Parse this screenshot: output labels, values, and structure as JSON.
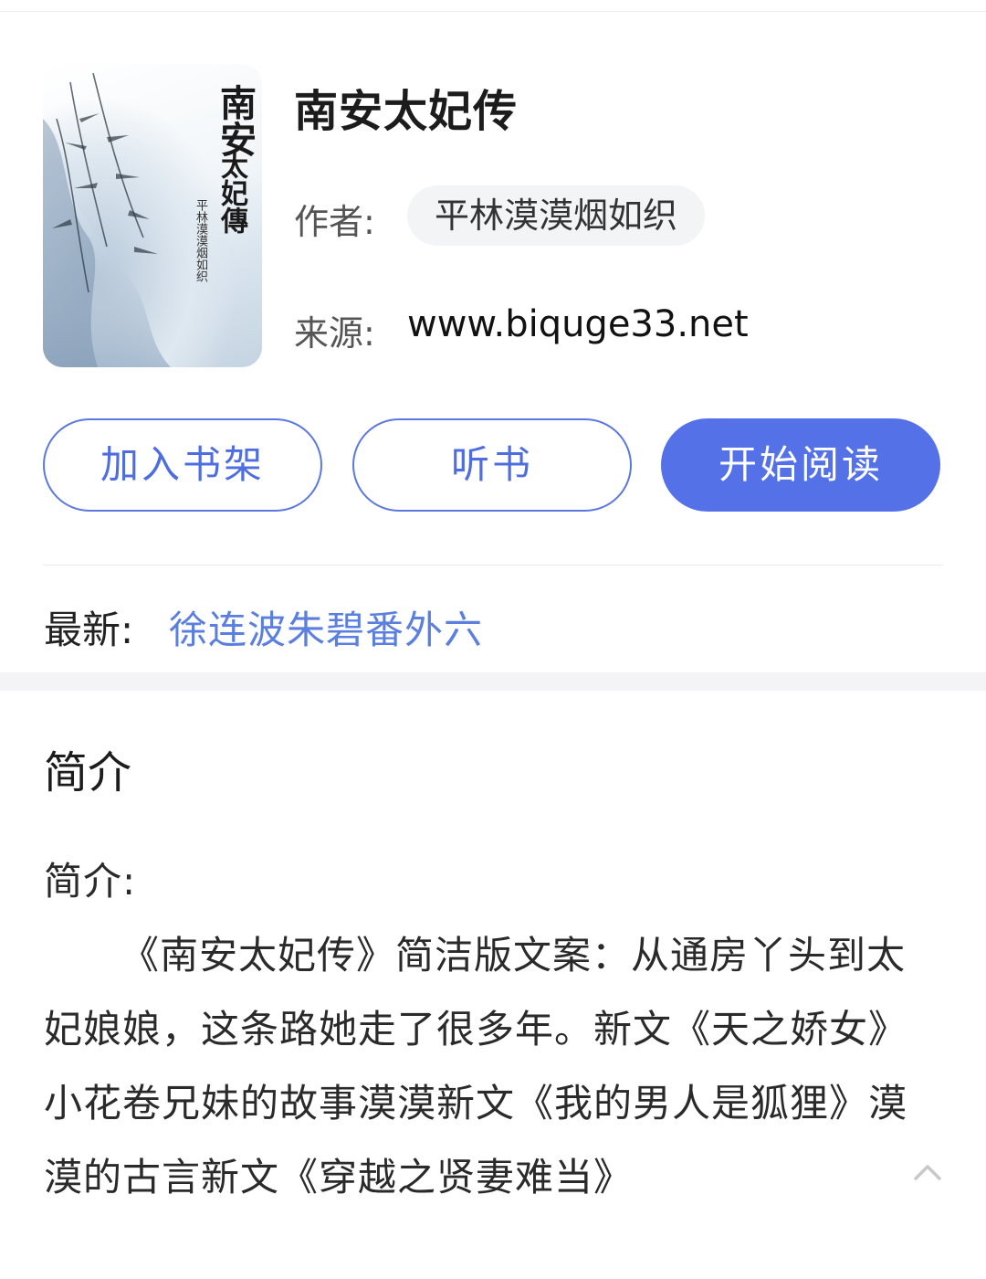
{
  "book": {
    "title": "南安太妃传",
    "author_label": "作者:",
    "author": "平林漠漠烟如织",
    "source_label": "来源:",
    "source": "www.biquge33.net",
    "cover": {
      "title": "南安",
      "subtitle": "太妃傳",
      "author": "平林漠漠烟如织"
    }
  },
  "actions": {
    "add_shelf": "加入书架",
    "listen": "听书",
    "start_read": "开始阅读"
  },
  "latest": {
    "label": "最新:",
    "chapter": "徐连波朱碧番外六"
  },
  "intro": {
    "heading": "简介",
    "prefix": "简介:",
    "text": "《南安太妃传》简洁版文案：从通房丫头到太妃娘娘，这条路她走了很多年。新文《天之娇女》小花卷兄妹的故事漠漠新文《我的男人是狐狸》漠漠的古言新文《穿越之贤妻难当》"
  },
  "icons": {
    "collapse": "chevron-up-icon"
  },
  "colors": {
    "accent": "#5471e8",
    "link": "#5a7fe0"
  }
}
